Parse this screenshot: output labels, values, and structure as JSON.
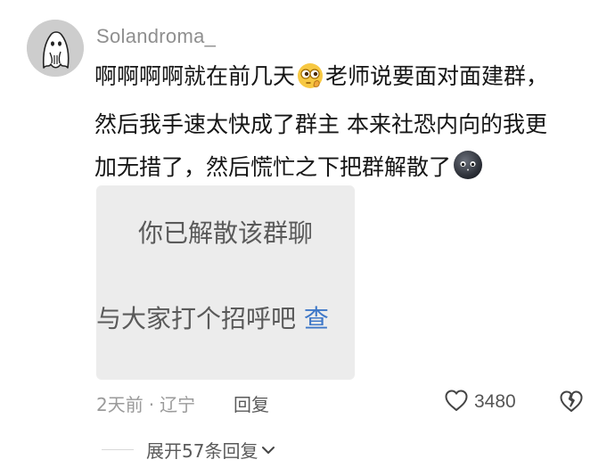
{
  "comment": {
    "username": "Solandroma_",
    "line1_text": "啊啊啊啊就在前几天",
    "line1_after_emoji": "老师说要面对面建群，",
    "line2": "然后我手速太快成了群主 本来社恐内向的我更",
    "line3": "加无措了，然后慌忙之下把群解散了",
    "emoji_1": "peeking-eyes-emoji",
    "emoji_2": "black-face-emoji",
    "image": {
      "line1": "你已解散该群聊",
      "line2": "与大家打个招呼吧",
      "link": "查"
    },
    "time": "2天前",
    "dot": "·",
    "location": "辽宁",
    "reply_label": "回复",
    "like_count": "3480",
    "expand_label": "展开57条回复"
  },
  "icons": {
    "like": "heart-outline-icon",
    "dislike": "broken-heart-icon",
    "expand": "chevron-down-icon"
  },
  "colors": {
    "text_primary": "#161616",
    "text_secondary": "#9a9a9a",
    "link": "#3f78c8",
    "card_bg": "#ececec"
  }
}
